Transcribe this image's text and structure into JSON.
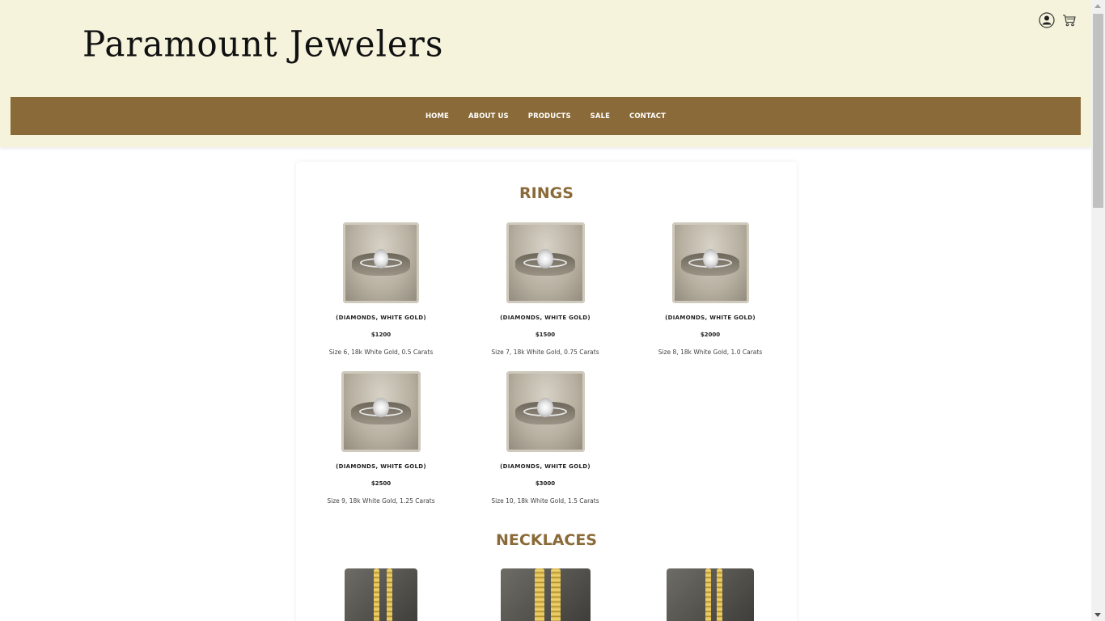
{
  "header": {
    "logo_text": "Paramount Jewelers",
    "icons": [
      "user-icon",
      "cart-icon"
    ]
  },
  "nav": {
    "items": [
      {
        "label": "HOME"
      },
      {
        "label": "ABOUT US"
      },
      {
        "label": "PRODUCTS"
      },
      {
        "label": "SALE"
      },
      {
        "label": "CONTACT"
      }
    ]
  },
  "colors": {
    "header_bg": "#f5f3dc",
    "nav_bg": "#8a6a38",
    "accent": "#8a6a38"
  },
  "sections": {
    "rings": {
      "title": "RINGS",
      "items": [
        {
          "tag": "(DIAMONDS, WHITE GOLD)",
          "price": "$1200",
          "desc": "Size 6, 18k White Gold, 0.5 Carats"
        },
        {
          "tag": "(DIAMONDS, WHITE GOLD)",
          "price": "$1500",
          "desc": "Size 7, 18k White Gold, 0.75 Carats"
        },
        {
          "tag": "(DIAMONDS, WHITE GOLD)",
          "price": "$2000",
          "desc": "Size 8, 18k White Gold, 1.0 Carats"
        },
        {
          "tag": "(DIAMONDS, WHITE GOLD)",
          "price": "$2500",
          "desc": "Size 9, 18k White Gold, 1.25 Carats"
        },
        {
          "tag": "(DIAMONDS, WHITE GOLD)",
          "price": "$3000",
          "desc": "Size 10, 18k White Gold, 1.5 Carats"
        }
      ]
    },
    "necklaces": {
      "title": "NECKLACES"
    }
  }
}
